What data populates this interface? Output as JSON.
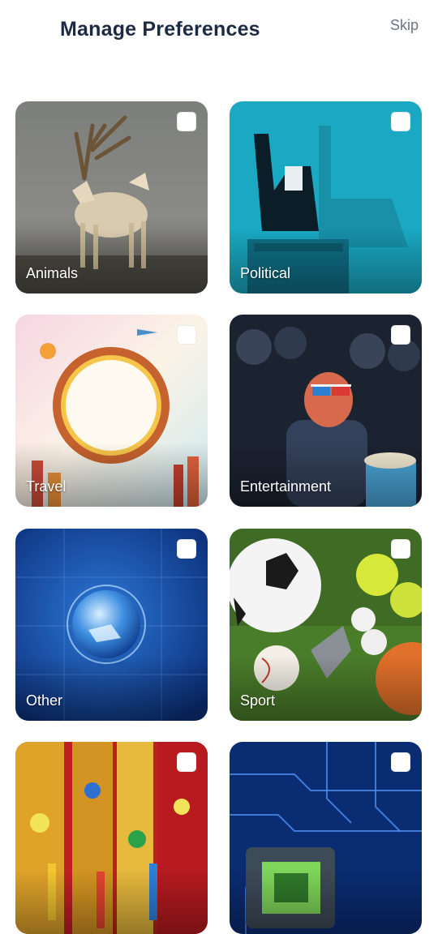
{
  "header": {
    "title": "Manage Preferences",
    "skip_label": "Skip"
  },
  "categories": [
    {
      "label": "Animals",
      "checked": false
    },
    {
      "label": "Political",
      "checked": false
    },
    {
      "label": "Travel",
      "checked": false
    },
    {
      "label": "Entertainment",
      "checked": false
    },
    {
      "label": "Other",
      "checked": false
    },
    {
      "label": "Sport",
      "checked": false
    },
    {
      "label": "",
      "checked": false
    },
    {
      "label": "",
      "checked": false
    }
  ]
}
